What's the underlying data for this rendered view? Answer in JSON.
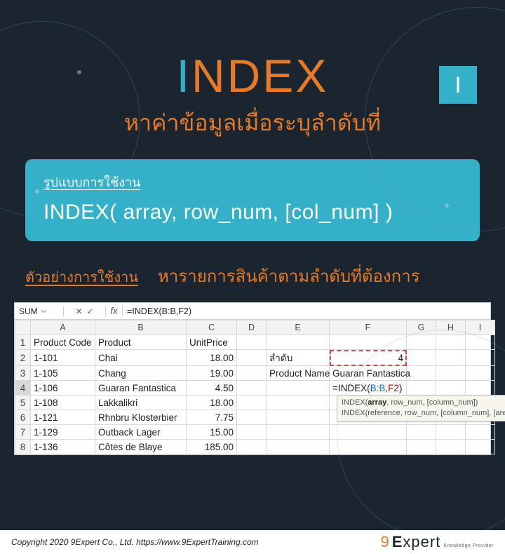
{
  "badge": "I",
  "title": {
    "first_letter": "I",
    "rest": "NDEX",
    "subtitle": "หาค่าข้อมูลเมื่อระบุลำดับที่"
  },
  "syntax": {
    "label": "รูปแบบการใช้งาน",
    "text": "INDEX( array, row_num, [col_num] )"
  },
  "example": {
    "label": "ตัวอย่างการใช้งาน",
    "text": "หารายการสินค้าตามลำดับที่ต้องการ"
  },
  "sheet": {
    "namebox": "SUM",
    "fx_content": "=INDEX(B:B,F2)",
    "columns": [
      "A",
      "B",
      "C",
      "D",
      "E",
      "F",
      "G",
      "H",
      "I"
    ],
    "headers": {
      "A": "Product Code",
      "B": "Product",
      "C": "UnitPrice"
    },
    "rows": [
      {
        "n": "1",
        "A": "Product Code",
        "B": "Product",
        "C": "UnitPrice",
        "E": "",
        "F": ""
      },
      {
        "n": "2",
        "A": "1-101",
        "B": "Chai",
        "C": "18.00",
        "E": "ลำดับ",
        "F": "4"
      },
      {
        "n": "3",
        "A": "1-105",
        "B": "Chang",
        "C": "19.00",
        "E": "Product Name",
        "F": "Guaran Fantastica"
      },
      {
        "n": "4",
        "A": "1-106",
        "B": "Guaran Fantastica",
        "C": "4.50",
        "E": "",
        "F": "=INDEX(B:B,F2)"
      },
      {
        "n": "5",
        "A": "1-108",
        "B": "Lakkalikri",
        "C": "18.00"
      },
      {
        "n": "6",
        "A": "1-121",
        "B": "Rhnbru Klosterbier",
        "C": "7.75"
      },
      {
        "n": "7",
        "A": "1-129",
        "B": "Outback Lager",
        "C": "15.00"
      },
      {
        "n": "8",
        "A": "1-136",
        "B": "Côtes de Blaye",
        "C": "185.00"
      }
    ],
    "formula_parts": {
      "pre": "=INDEX(",
      "arg1": "B:B",
      "sep": ",",
      "arg2": "F2",
      "post": ")"
    },
    "tooltip": {
      "line1_pre": "INDEX(",
      "line1_b": "array",
      "line1_post": ", row_num, [column_num])",
      "line2": "INDEX(reference, row_num, [column_num], [area_num])"
    }
  },
  "footer": {
    "copyright": "Copyright 2020 9Expert Co., Ltd.   https://www.9ExpertTraining.com",
    "logo_nine": "9",
    "logo_e": "E",
    "logo_xpert": "xpert",
    "logo_tag": "Knowledge Provider"
  }
}
